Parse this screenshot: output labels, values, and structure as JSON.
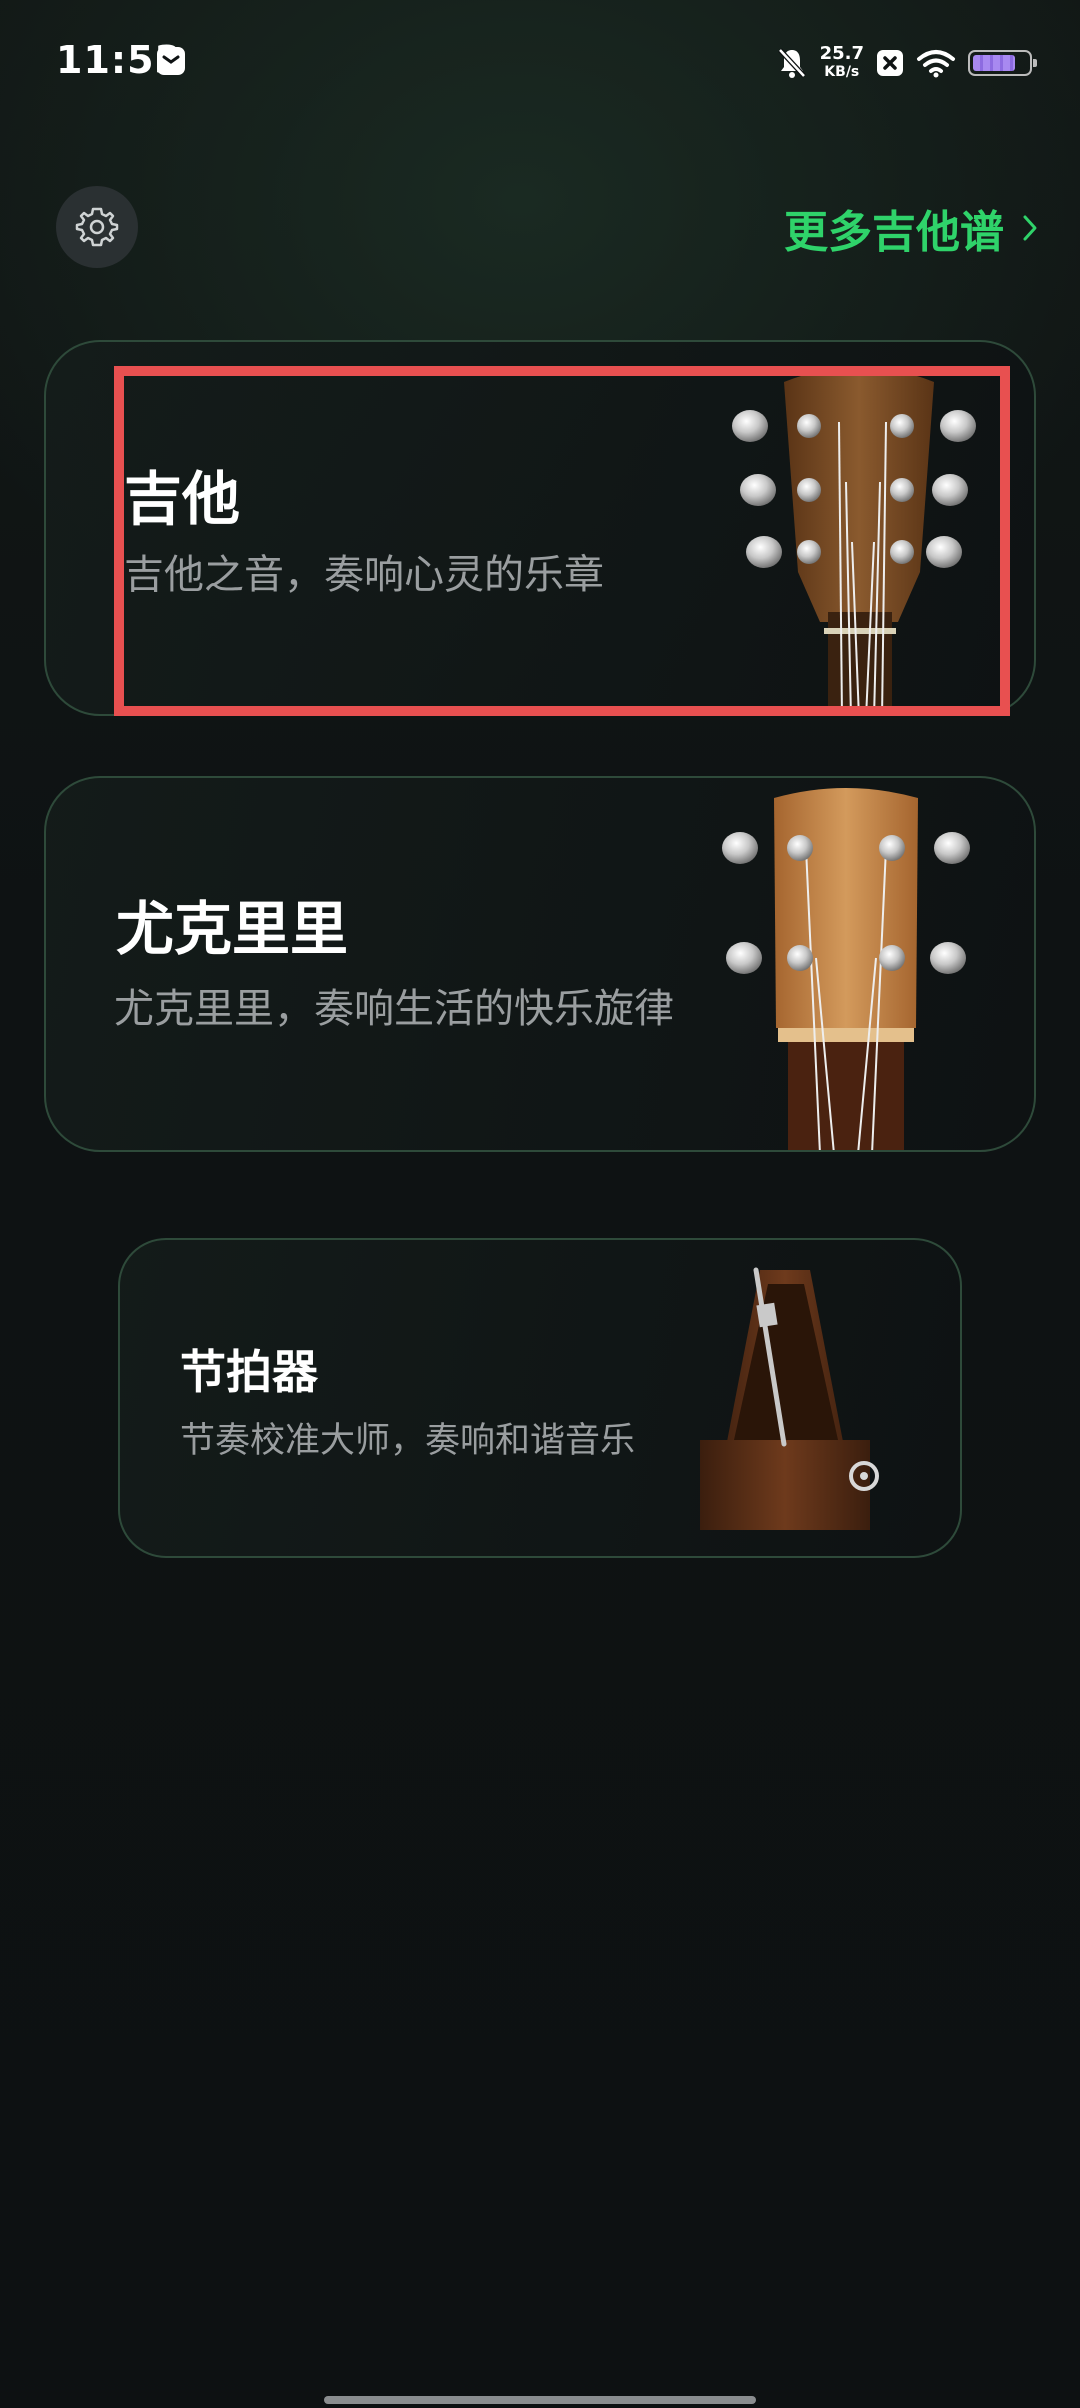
{
  "status_bar": {
    "time": "11:53",
    "net_speed_value": "25.7",
    "net_speed_unit": "KB/s",
    "icons": [
      "message-icon",
      "bell-muted-icon",
      "close-box-icon",
      "wifi-icon",
      "battery-icon"
    ],
    "battery_color": "#a889f0"
  },
  "header": {
    "settings_icon": "gear-icon",
    "more_link_label": "更多吉他谱",
    "more_link_icon": "chevron-right-icon",
    "accent_color": "#2fd36a"
  },
  "cards": [
    {
      "title": "吉他",
      "subtitle": "吉他之音，奏响心灵的乐章",
      "art": "guitar-headstock-image"
    },
    {
      "title": "尤克里里",
      "subtitle": "尤克里里，奏响生活的快乐旋律",
      "art": "ukulele-headstock-image"
    },
    {
      "title": "节拍器",
      "subtitle": "节奏校准大师，奏响和谐音乐",
      "art": "metronome-image"
    }
  ]
}
